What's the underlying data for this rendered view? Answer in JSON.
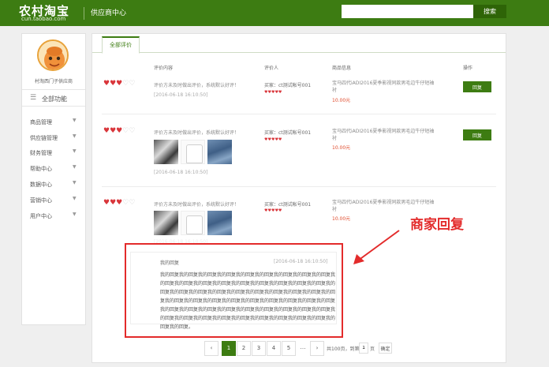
{
  "header": {
    "logo_main": "农村淘宝",
    "logo_sub": "cun.taobao.com",
    "subtitle": "供应商中心",
    "search_placeholder": "",
    "search_button": "搜索"
  },
  "sidebar": {
    "shop_name": "村淘西门子供应商",
    "all_functions": "全部功能",
    "items": [
      {
        "label": "商品管理"
      },
      {
        "label": "供应链管理"
      },
      {
        "label": "财务管理"
      },
      {
        "label": "帮助中心"
      },
      {
        "label": "数据中心"
      },
      {
        "label": "营销中心"
      },
      {
        "label": "用户中心"
      }
    ]
  },
  "main": {
    "tab": "全部评价",
    "columns": {
      "content": "评价内容",
      "reviewer": "评价人",
      "product": "商品信息",
      "action": "操作"
    },
    "reviews": [
      {
        "rating": 3,
        "text": "评价方未及时做出评价，系统默认好评！",
        "time": "[2016-06-18 16:10:50]",
        "buyer": "买家：ct测试帐号001",
        "product": "宝马四代iADI2016夏季影视同款男毛边牛仔短袖衬",
        "price": "10.00元",
        "reply_button": "回复"
      },
      {
        "rating": 3,
        "text": "评价方未及时做出评价，系统默认好评！",
        "time": "[2016-06-18 16:10:50]",
        "buyer": "买家：ct测试帐号001",
        "product": "宝马四代iADI2016夏季影视同款男毛边牛仔短袖衬",
        "price": "10.00元",
        "reply_button": "回复"
      },
      {
        "rating": 3,
        "text": "评价方未及时做出评价，系统默认好评！",
        "time": "[2016-06-18 16:10:50]",
        "buyer": "买家：ct测试帐号001",
        "product": "宝马四代iADI2016夏季影视同款男毛边牛仔短袖衬",
        "price": "10.00元"
      }
    ],
    "merchant_reply": {
      "title": "我的回复",
      "time": "[2016-06-18 16:10:50]",
      "body": "我的回复我的回复我的回复我的回复我的回复我的回复我的回复我的回复我的回复我的回复我的回复我的回复我的回复我的回复我的回复我的回复我的回复我的回复我的回复我的回复我的回复我的回复我的回复我的回复我的回复我的回复我的回复我的回复我的回复我的回复我的回复我的回复我的回复我的回复我的回复我的回复我的回复我的回复我的回复我的回复我的回复我的回复我的回复我的回复我的回复我的回复我的回复我的回复我的回复我的回复我的回复我的回复我的回复我的回复我的回复我的回复我的回复。"
    },
    "pagination": {
      "prev": "‹",
      "pages": [
        "1",
        "2",
        "3",
        "4",
        "5"
      ],
      "ellipsis": "…",
      "next": "›",
      "total_text": "共100页，到第",
      "page_input": "1",
      "page_suffix": "页",
      "confirm": "确定"
    }
  },
  "annotation": {
    "label": "商家回复"
  },
  "colors": {
    "brand_green": "#3d7c12",
    "annotation_red": "#e32b2b",
    "price_red": "#e04b2c"
  }
}
